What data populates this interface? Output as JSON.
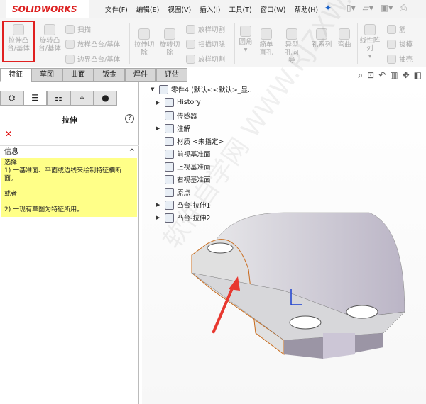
{
  "app": {
    "logo": "SOLIDWORKS"
  },
  "menu": [
    "文件(F)",
    "编辑(E)",
    "视图(V)",
    "插入(I)",
    "工具(T)",
    "窗口(W)",
    "帮助(H)"
  ],
  "toolbar": {
    "extrude_boss": "拉伸凸台/基体",
    "revolve_boss": "旋转凸台/基体",
    "sweep": "扫描",
    "loft": "放样凸台/基体",
    "boundary": "边界凸台/基体",
    "extrude_cut": "拉伸切除",
    "revolve_cut": "旋转切除",
    "loft_cut": "放样切割",
    "sweep_cut": "扫描切除",
    "boundary_cut": "放样切割",
    "fillet": "圆角",
    "simple_hole": "简单直孔",
    "hole_wizard": "异型孔向导",
    "hole_series": "孔系列",
    "flex": "弯曲",
    "linear_pattern": "线性阵列",
    "rib": "筋",
    "draft": "拔模",
    "shell": "抽壳"
  },
  "tabs": [
    "特征",
    "草图",
    "曲面",
    "钣金",
    "焊件",
    "评估"
  ],
  "panel": {
    "title": "拉伸",
    "info_header": "信息",
    "info_lines": [
      "选择:",
      "1) 一基准面、平面或边线来绘制特征横断面。",
      "",
      "或者",
      "",
      "2) 一现有草图为特征所用。"
    ]
  },
  "tree": {
    "root": "零件4  (默认<<默认>_显...",
    "items": [
      "History",
      "传感器",
      "注解",
      "材质 <未指定>",
      "前视基准面",
      "上视基准面",
      "右视基准面",
      "原点",
      "凸台-拉伸1",
      "凸台-拉伸2"
    ]
  },
  "watermark": "软件自学网 WWW.RJZXW.COM",
  "colors": {
    "highlight": "#e02020",
    "info_bg": "#ffff88",
    "arrow": "#e8382f"
  }
}
